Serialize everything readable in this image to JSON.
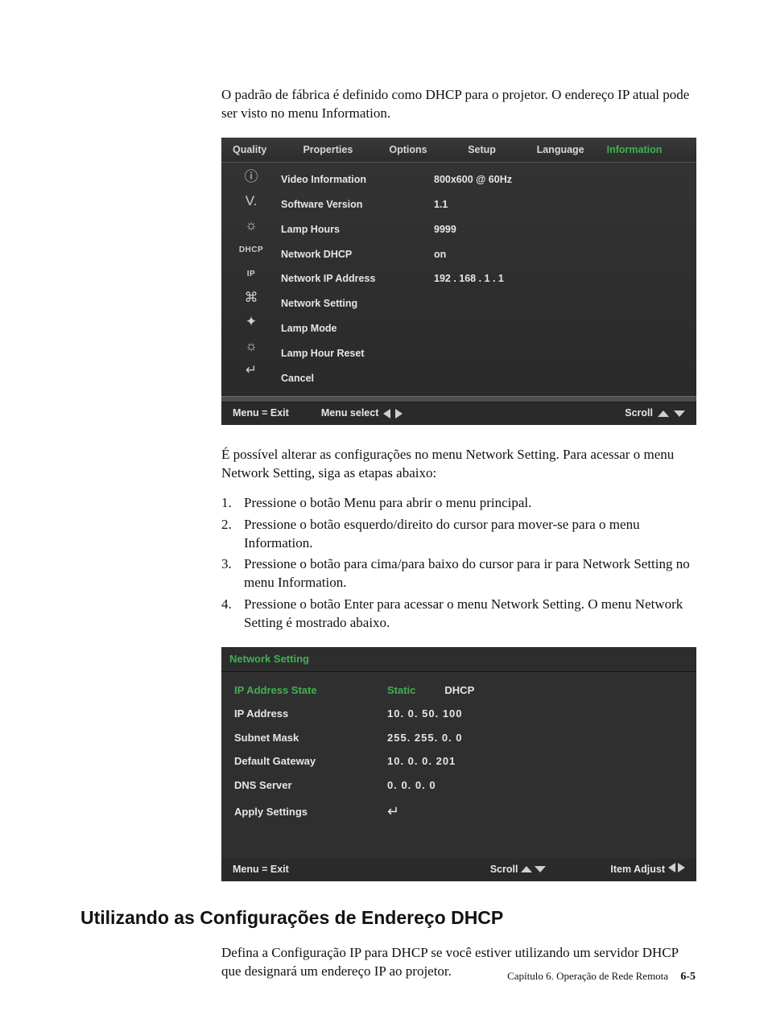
{
  "intro": "O padrão de fábrica é definido como DHCP para o projetor. O endereço IP atual pode ser visto no menu Information.",
  "osd1": {
    "tabs": [
      "Quality",
      "Properties",
      "Options",
      "Setup",
      "Language",
      "Information"
    ],
    "active_tab_index": 5,
    "items": [
      {
        "label": "Video Information",
        "value": "800x600 @ 60Hz"
      },
      {
        "label": "Software Version",
        "value": "1.1"
      },
      {
        "label": "Lamp Hours",
        "value": "9999"
      },
      {
        "label": "Network DHCP",
        "value": "on"
      },
      {
        "label": "Network IP Address",
        "value": "192 . 168 . 1 . 1"
      },
      {
        "label": "Network Setting",
        "value": ""
      },
      {
        "label": "Lamp Mode",
        "value": ""
      },
      {
        "label": "Lamp Hour Reset",
        "value": ""
      },
      {
        "label": "Cancel",
        "value": ""
      }
    ],
    "status": {
      "exit": "Menu = Exit",
      "select": "Menu select",
      "scroll": "Scroll"
    }
  },
  "mid_text": "É possível alterar as configurações no menu Network Setting. Para acessar o menu Network Setting, siga as etapas abaixo:",
  "steps": [
    "Pressione o botão Menu para abrir o menu principal.",
    "Pressione o botão esquerdo/direito do cursor para mover-se para o menu Information.",
    "Pressione o botão para cima/para baixo do cursor para ir para Network Setting no menu Information.",
    "Pressione o botão Enter para acessar o menu Network Setting. O menu Network Setting é mostrado abaixo."
  ],
  "osd2": {
    "title": "Network Setting",
    "rows": [
      {
        "label": "IP Address State",
        "options": [
          "Static",
          "DHCP"
        ],
        "selected": "Static"
      },
      {
        "label": "IP Address",
        "value": "10.   0.  50. 100"
      },
      {
        "label": "Subnet Mask",
        "value": "255. 255.   0.   0"
      },
      {
        "label": "Default Gateway",
        "value": "10.   0.   0. 201"
      },
      {
        "label": "DNS Server",
        "value": "0.   0.   0.   0"
      },
      {
        "label": "Apply Settings",
        "value": "↵"
      }
    ],
    "status": {
      "exit": "Menu = Exit",
      "scroll": "Scroll",
      "adjust": "Item Adjust"
    }
  },
  "section_title": "Utilizando as Configurações de Endereço DHCP",
  "section_body": "Defina a Configuração IP para DHCP se você estiver utilizando um servidor DHCP que designará um endereço IP ao projetor.",
  "footer": {
    "chapter": "Capítulo 6. Operação de Rede Remota",
    "page": "6-5"
  }
}
